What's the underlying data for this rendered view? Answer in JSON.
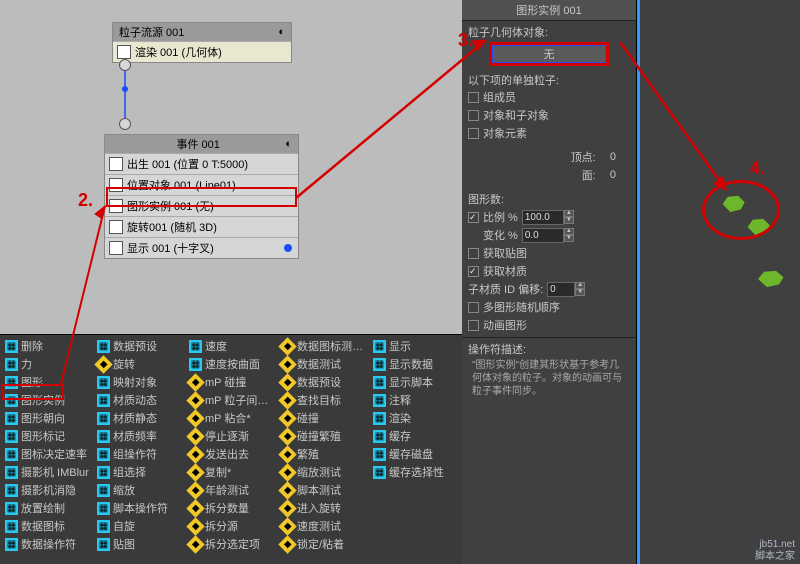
{
  "schematic": {
    "flow": {
      "title": "粒子流源 001",
      "render_row": "渲染 001 (几何体)"
    },
    "event": {
      "title": "事件 001",
      "rows": {
        "birth": "出生 001 (位置 0 T:5000)",
        "position": "位置对象 001 (Line01)",
        "shape": "图形实例 001 (无)",
        "rotate": "旋转001 (随机 3D)",
        "display": "显示 001 (十字叉)"
      }
    }
  },
  "depot": {
    "col1": [
      "删除",
      "力",
      "图形",
      "图形实例",
      "图形朝向",
      "图形标记",
      "图标决定速率",
      "摄影机 IMBlur",
      "摄影机消隐",
      "放置绘制",
      "数据图标",
      "数据操作符",
      "数据预设",
      "旋转"
    ],
    "col2": [
      "映射对象",
      "材质动态",
      "材质静态",
      "材质频率",
      "组操作符",
      "组选择",
      "缩放",
      "脚本操作符",
      "自旋",
      "贴图",
      "速度",
      "速度按曲面",
      "mP 碰撞",
      "mP 粒子间…"
    ],
    "col3": [
      "mP 粘合*",
      "停止逐渐",
      "发送出去",
      "复制*",
      "年龄测试",
      "拆分数量",
      "拆分源",
      "拆分选定项",
      "数据图标测…",
      "数据测试",
      "数据预设",
      "查找目标",
      "碰撞"
    ],
    "col4": [
      "碰撞繁殖",
      "繁殖",
      "缩放测试",
      "脚本测试",
      "进入旋转",
      "速度测试",
      "锁定/粘着",
      "显示",
      "显示数据",
      "显示脚本",
      "注释",
      "渲染",
      "缓存",
      "缓存磁盘"
    ],
    "col5": [
      "缓存选择性"
    ]
  },
  "params": {
    "title": "图形实例 001",
    "geom_label": "粒子几何体对象:",
    "none_btn": "无",
    "separate_label": "以下项的单独粒子:",
    "cb_group": "组成员",
    "cb_objchild": "对象和子对象",
    "cb_objelem": "对象元素",
    "vert_label": "顶点:",
    "vert_val": "0",
    "face_label": "面:",
    "face_val": "0",
    "shapes_label": "图形数:",
    "ratio_label": "比例 %",
    "ratio_val": "100.0",
    "var_label": "变化 %",
    "var_val": "0.0",
    "cb_getmap": "获取贴图",
    "cb_getmat": "获取材质",
    "submat_label": "子材质 ID 偏移:",
    "submat_val": "0",
    "cb_multiorder": "多图形随机顺序",
    "cb_anim": "动画图形",
    "opdesc_title": "操作符描述:",
    "opdesc_text": "\"图形实例\"创建其形状基于参考几何体对象的粒子。对象的动画可与粒子事件同步。"
  },
  "labels": {
    "n2": "2.",
    "n3": "3.",
    "n4": "4."
  },
  "watermark1": "jb51.net",
  "watermark2": "脚本之家"
}
